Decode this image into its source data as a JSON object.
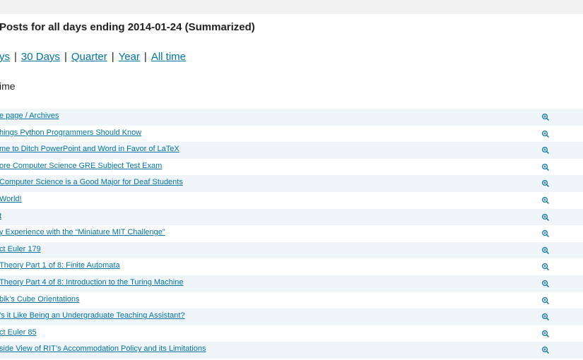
{
  "heading": "Posts for all days ending 2014-01-24 (Summarized)",
  "periods": [
    "ys",
    "30 Days",
    "Quarter",
    "Year",
    "All time"
  ],
  "subheading": "ime",
  "rows": [
    "e page / Archives",
    "hings Python Programmers Should Know",
    "me to Ditch PowerPoint and Word in Favor of LaTeX",
    "ore Computer Science GRE Subject Test Exam",
    "Computer Science is a Good Major for Deaf Students",
    "World!",
    "t",
    "y Experience with the “Miniature MIT Challenge”",
    "ct Euler 179",
    "Theory Part 1 of 8: Finite Automata",
    "Theory Part 4 of 8: Introduction to the Turing Machine",
    "bik’s Cube Orientations",
    "’s it Like Being an Undergraduate Teaching Assistant?",
    "ct Euler 85",
    "side View of RIT’s Accommodation Policy and its Limitations"
  ],
  "colors": {
    "link": "#0074a2",
    "row_stripe": "#f0f5fa",
    "top_bar": "#f1f1f1"
  },
  "icons": {
    "row_action": "zoom-in-icon"
  }
}
